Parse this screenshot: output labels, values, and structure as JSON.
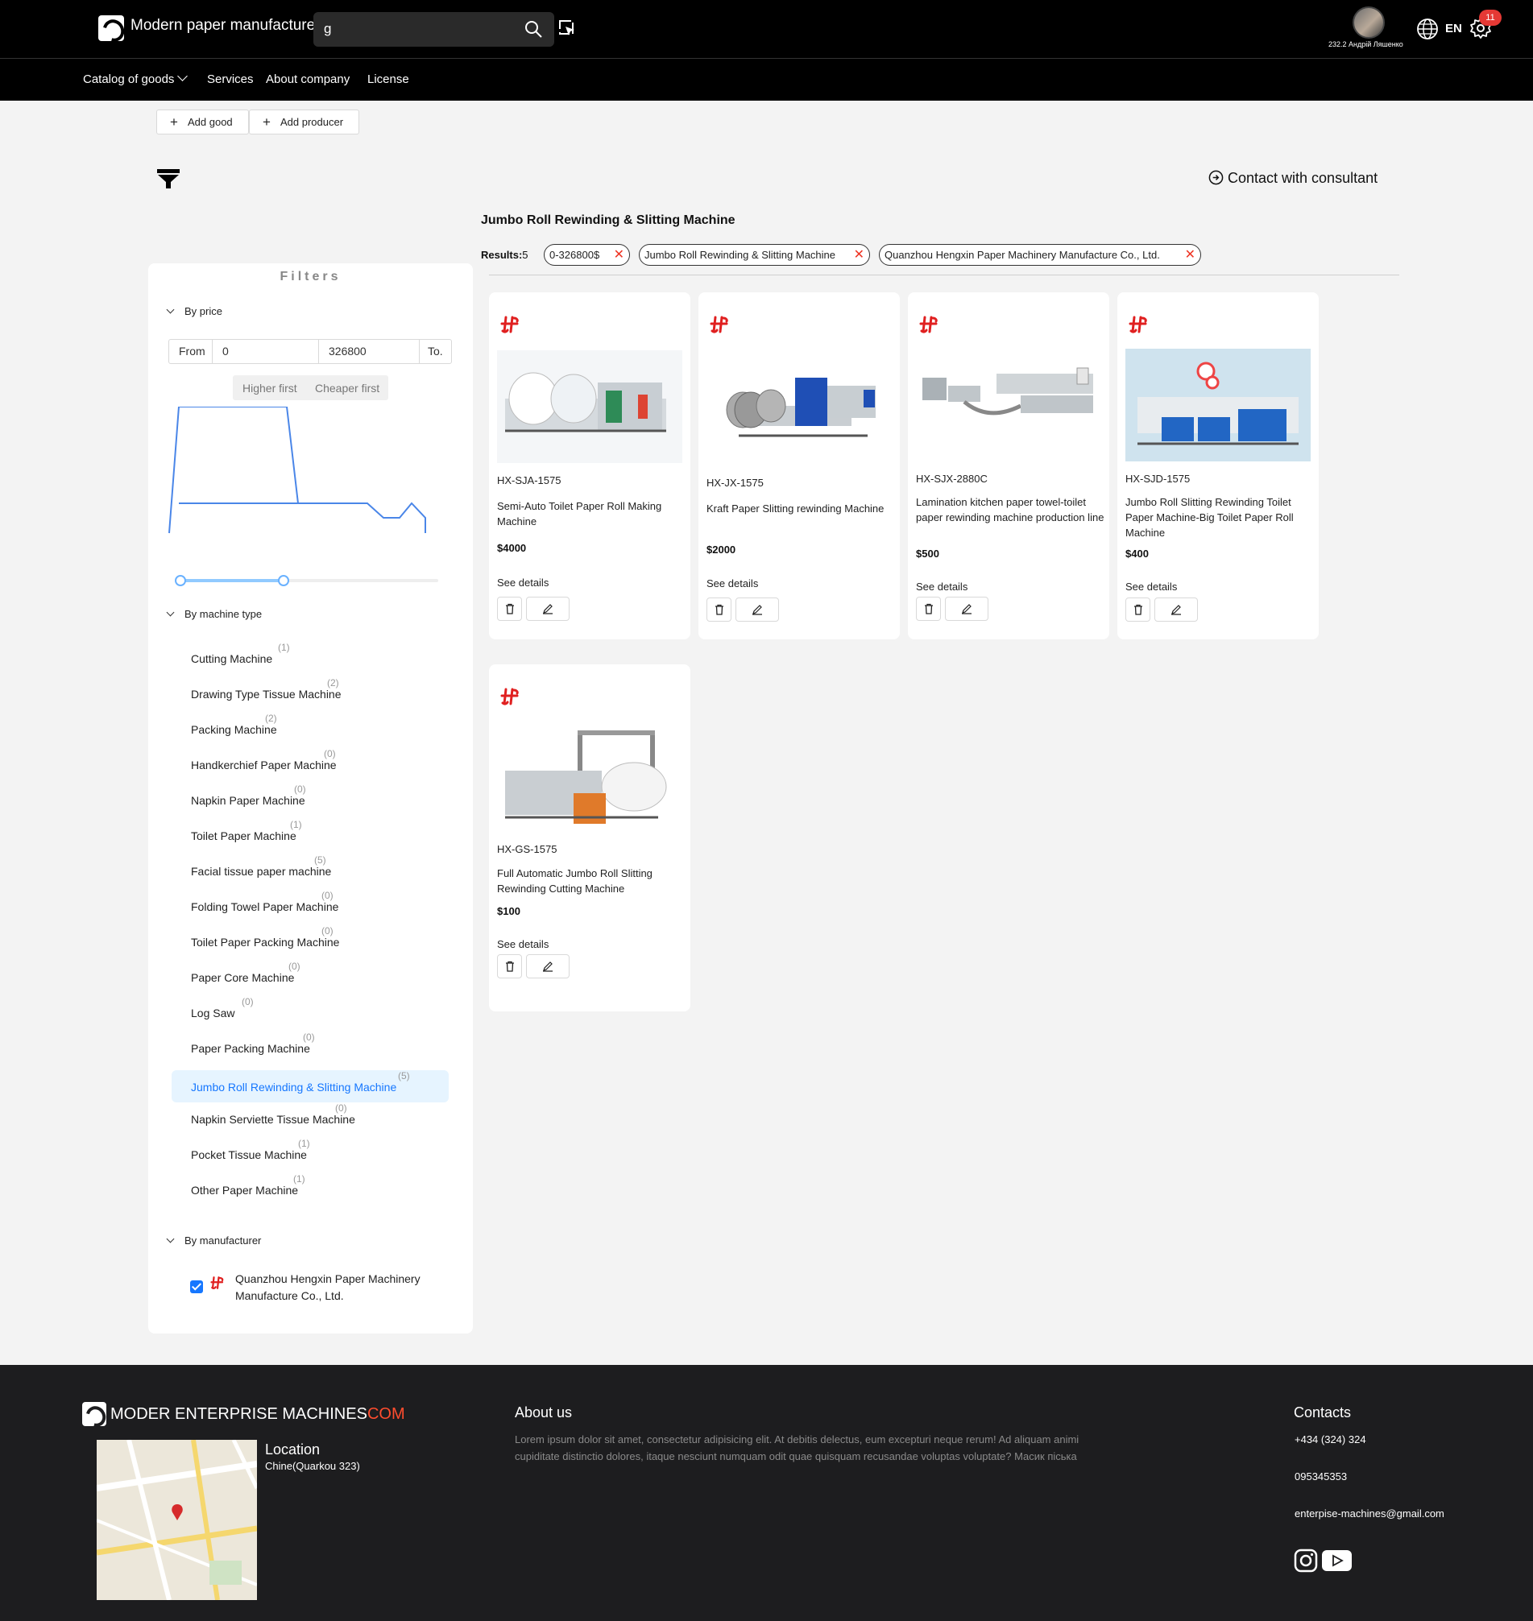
{
  "header": {
    "brand": "Modern paper manufacture",
    "search_value": "g",
    "user_name": "232.2 Андрій Ляшенко",
    "language": "EN",
    "notifications": "11"
  },
  "nav": {
    "items": [
      "Catalog of goods",
      "Services",
      "About company",
      "License"
    ]
  },
  "actions": {
    "add_good": "Add good",
    "add_producer": "Add producer",
    "contact_consultant": "Contact with consultant"
  },
  "filters": {
    "title": "Filters",
    "by_price": "By price",
    "from_label": "From",
    "from_value": "0",
    "to_value": "326800",
    "to_label": "To.",
    "sort_higher": "Higher first",
    "sort_cheaper": "Cheaper first",
    "price_range_selected": [
      0,
      326800
    ],
    "by_machine_type": "By machine type",
    "machine_types": [
      {
        "label": "Cutting Machine",
        "count": "(1)"
      },
      {
        "label": "Drawing Type Tissue Machine",
        "count": "(2)"
      },
      {
        "label": "Packing Machine",
        "count": "(2)"
      },
      {
        "label": "Handkerchief Paper Machine",
        "count": "(0)"
      },
      {
        "label": "Napkin Paper Machine",
        "count": "(0)"
      },
      {
        "label": "Toilet Paper Machine",
        "count": "(1)"
      },
      {
        "label": "Facial tissue paper machine",
        "count": "(5)"
      },
      {
        "label": "Folding Towel Paper Machine",
        "count": "(0)"
      },
      {
        "label": "Toilet Paper Packing Machine",
        "count": "(0)"
      },
      {
        "label": "Paper Core Machine",
        "count": "(0)"
      },
      {
        "label": "Log Saw",
        "count": "(0)"
      },
      {
        "label": "Paper Packing Machine",
        "count": "(0)"
      },
      {
        "label": "Jumbo Roll Rewinding & Slitting Machine",
        "count": "(5)"
      },
      {
        "label": "Napkin Serviette Tissue Machine",
        "count": "(0)"
      },
      {
        "label": "Pocket Tissue Machine",
        "count": "(1)"
      },
      {
        "label": "Other Paper Machine",
        "count": "(1)"
      }
    ],
    "by_manufacturer": "By manufacturer",
    "manufacturer": "Quanzhou Hengxin Paper Machinery Manufacture Co., Ltd."
  },
  "results": {
    "title": "Jumbo Roll Rewinding & Slitting Machine",
    "label": "Results:",
    "count": "5",
    "tags": [
      "0-326800$",
      "Jumbo Roll Rewinding & Slitting Machine",
      "Quanzhou Hengxin Paper Machinery Manufacture Co., Ltd."
    ]
  },
  "products": [
    {
      "sku": "HX-SJA-1575",
      "name": "Semi-Auto Toilet Paper Roll Making Machine",
      "price": "$4000",
      "details": "See details"
    },
    {
      "sku": "HX-JX-1575",
      "name": "Kraft Paper Slitting rewinding Machine",
      "price": "$2000",
      "details": "See details"
    },
    {
      "sku": "HX-SJX-2880C",
      "name": "Lamination kitchen paper towel-toilet paper rewinding machine production line",
      "price": "$500",
      "details": "See details"
    },
    {
      "sku": "HX-SJD-1575",
      "name": "Jumbo Roll Slitting Rewinding Toilet Paper Machine-Big Toilet Paper Roll Machine",
      "price": "$400",
      "details": "See details"
    },
    {
      "sku": "HX-GS-1575",
      "name": "Full Automatic Jumbo Roll Slitting Rewinding Cutting Machine",
      "price": "$100",
      "details": "See details"
    }
  ],
  "footer": {
    "brand": "MODER ENTERPRISE MACHINES",
    "brand_suffix": "COM",
    "location_title": "Location",
    "location_value": "Chine(Quarkou 323)",
    "about_title": "About us",
    "about_text": "Lorem ipsum dolor sit amet, consectetur adipisicing elit. At debitis delectus, eum excepturi neque rerum! Ad aliquam animi cupiditate distinctio dolores, itaque nesciunt numquam odit quae quisquam recusandae voluptas voluptate? Масик піська",
    "contacts_title": "Contacts",
    "phone1": "+434 (324) 324",
    "phone2": "095345353",
    "email": "enterpise-machines@gmail.com"
  },
  "colors": {
    "accent": "#1677ff",
    "header_bg": "#000000",
    "footer_bg": "#1d1d1f",
    "brand_red": "#ff4d2e"
  }
}
